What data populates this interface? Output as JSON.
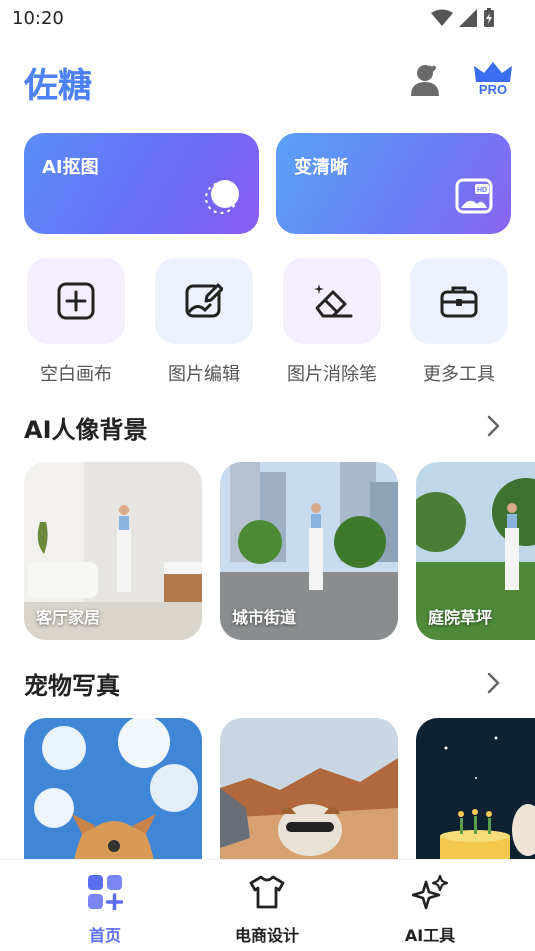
{
  "status_bar": {
    "time": "10:20"
  },
  "header": {
    "title": "佐糖",
    "pro_badge": "PRO"
  },
  "feature_cards": [
    {
      "label": "AI抠图",
      "icon": "cutout-icon"
    },
    {
      "label": "变清晰",
      "icon": "hd-icon",
      "icon_text": "HD"
    }
  ],
  "tools": [
    {
      "label": "空白画布",
      "icon": "plus-square-icon"
    },
    {
      "label": "图片编辑",
      "icon": "image-edit-icon"
    },
    {
      "label": "图片消除笔",
      "icon": "eraser-icon"
    },
    {
      "label": "更多工具",
      "icon": "toolbox-icon"
    }
  ],
  "sections": [
    {
      "title": "AI人像背景",
      "items": [
        "客厅家居",
        "城市街道",
        "庭院草坪"
      ]
    },
    {
      "title": "宠物写真",
      "items": [
        "",
        "",
        ""
      ]
    }
  ],
  "bottom_nav": [
    {
      "label": "首页",
      "icon": "home-grid-icon",
      "active": true
    },
    {
      "label": "电商设计",
      "icon": "tshirt-icon",
      "active": false
    },
    {
      "label": "AI工具",
      "icon": "sparkles-icon",
      "active": false
    }
  ],
  "colors": {
    "accent": "#5b6ef0",
    "brand": "#4d82f7"
  }
}
